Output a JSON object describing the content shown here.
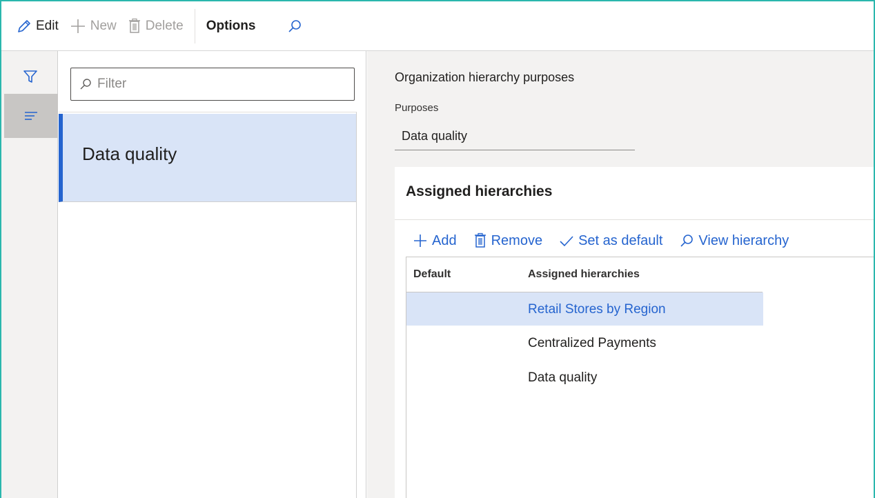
{
  "toolbar": {
    "edit_label": "Edit",
    "new_label": "New",
    "delete_label": "Delete",
    "options_label": "Options"
  },
  "list": {
    "filter_placeholder": "Filter",
    "items": [
      {
        "label": "Data quality",
        "selected": true
      }
    ]
  },
  "details": {
    "section_title": "Organization hierarchy purposes",
    "purposes_label": "Purposes",
    "purposes_value": "Data quality",
    "card": {
      "title": "Assigned hierarchies",
      "actions": {
        "add": "Add",
        "remove": "Remove",
        "set_default": "Set as default",
        "view_hierarchy": "View hierarchy"
      },
      "grid": {
        "columns": [
          "Default",
          "Assigned hierarchies"
        ],
        "rows": [
          {
            "default": "",
            "hierarchy": "Retail Stores by Region",
            "selected": true
          },
          {
            "default": "",
            "hierarchy": "Centralized Payments",
            "selected": false
          },
          {
            "default": "",
            "hierarchy": "Data quality",
            "selected": false
          }
        ]
      }
    }
  },
  "colors": {
    "accent": "#2564cf",
    "selection": "#d9e4f7",
    "frame": "#2ab7ad"
  }
}
